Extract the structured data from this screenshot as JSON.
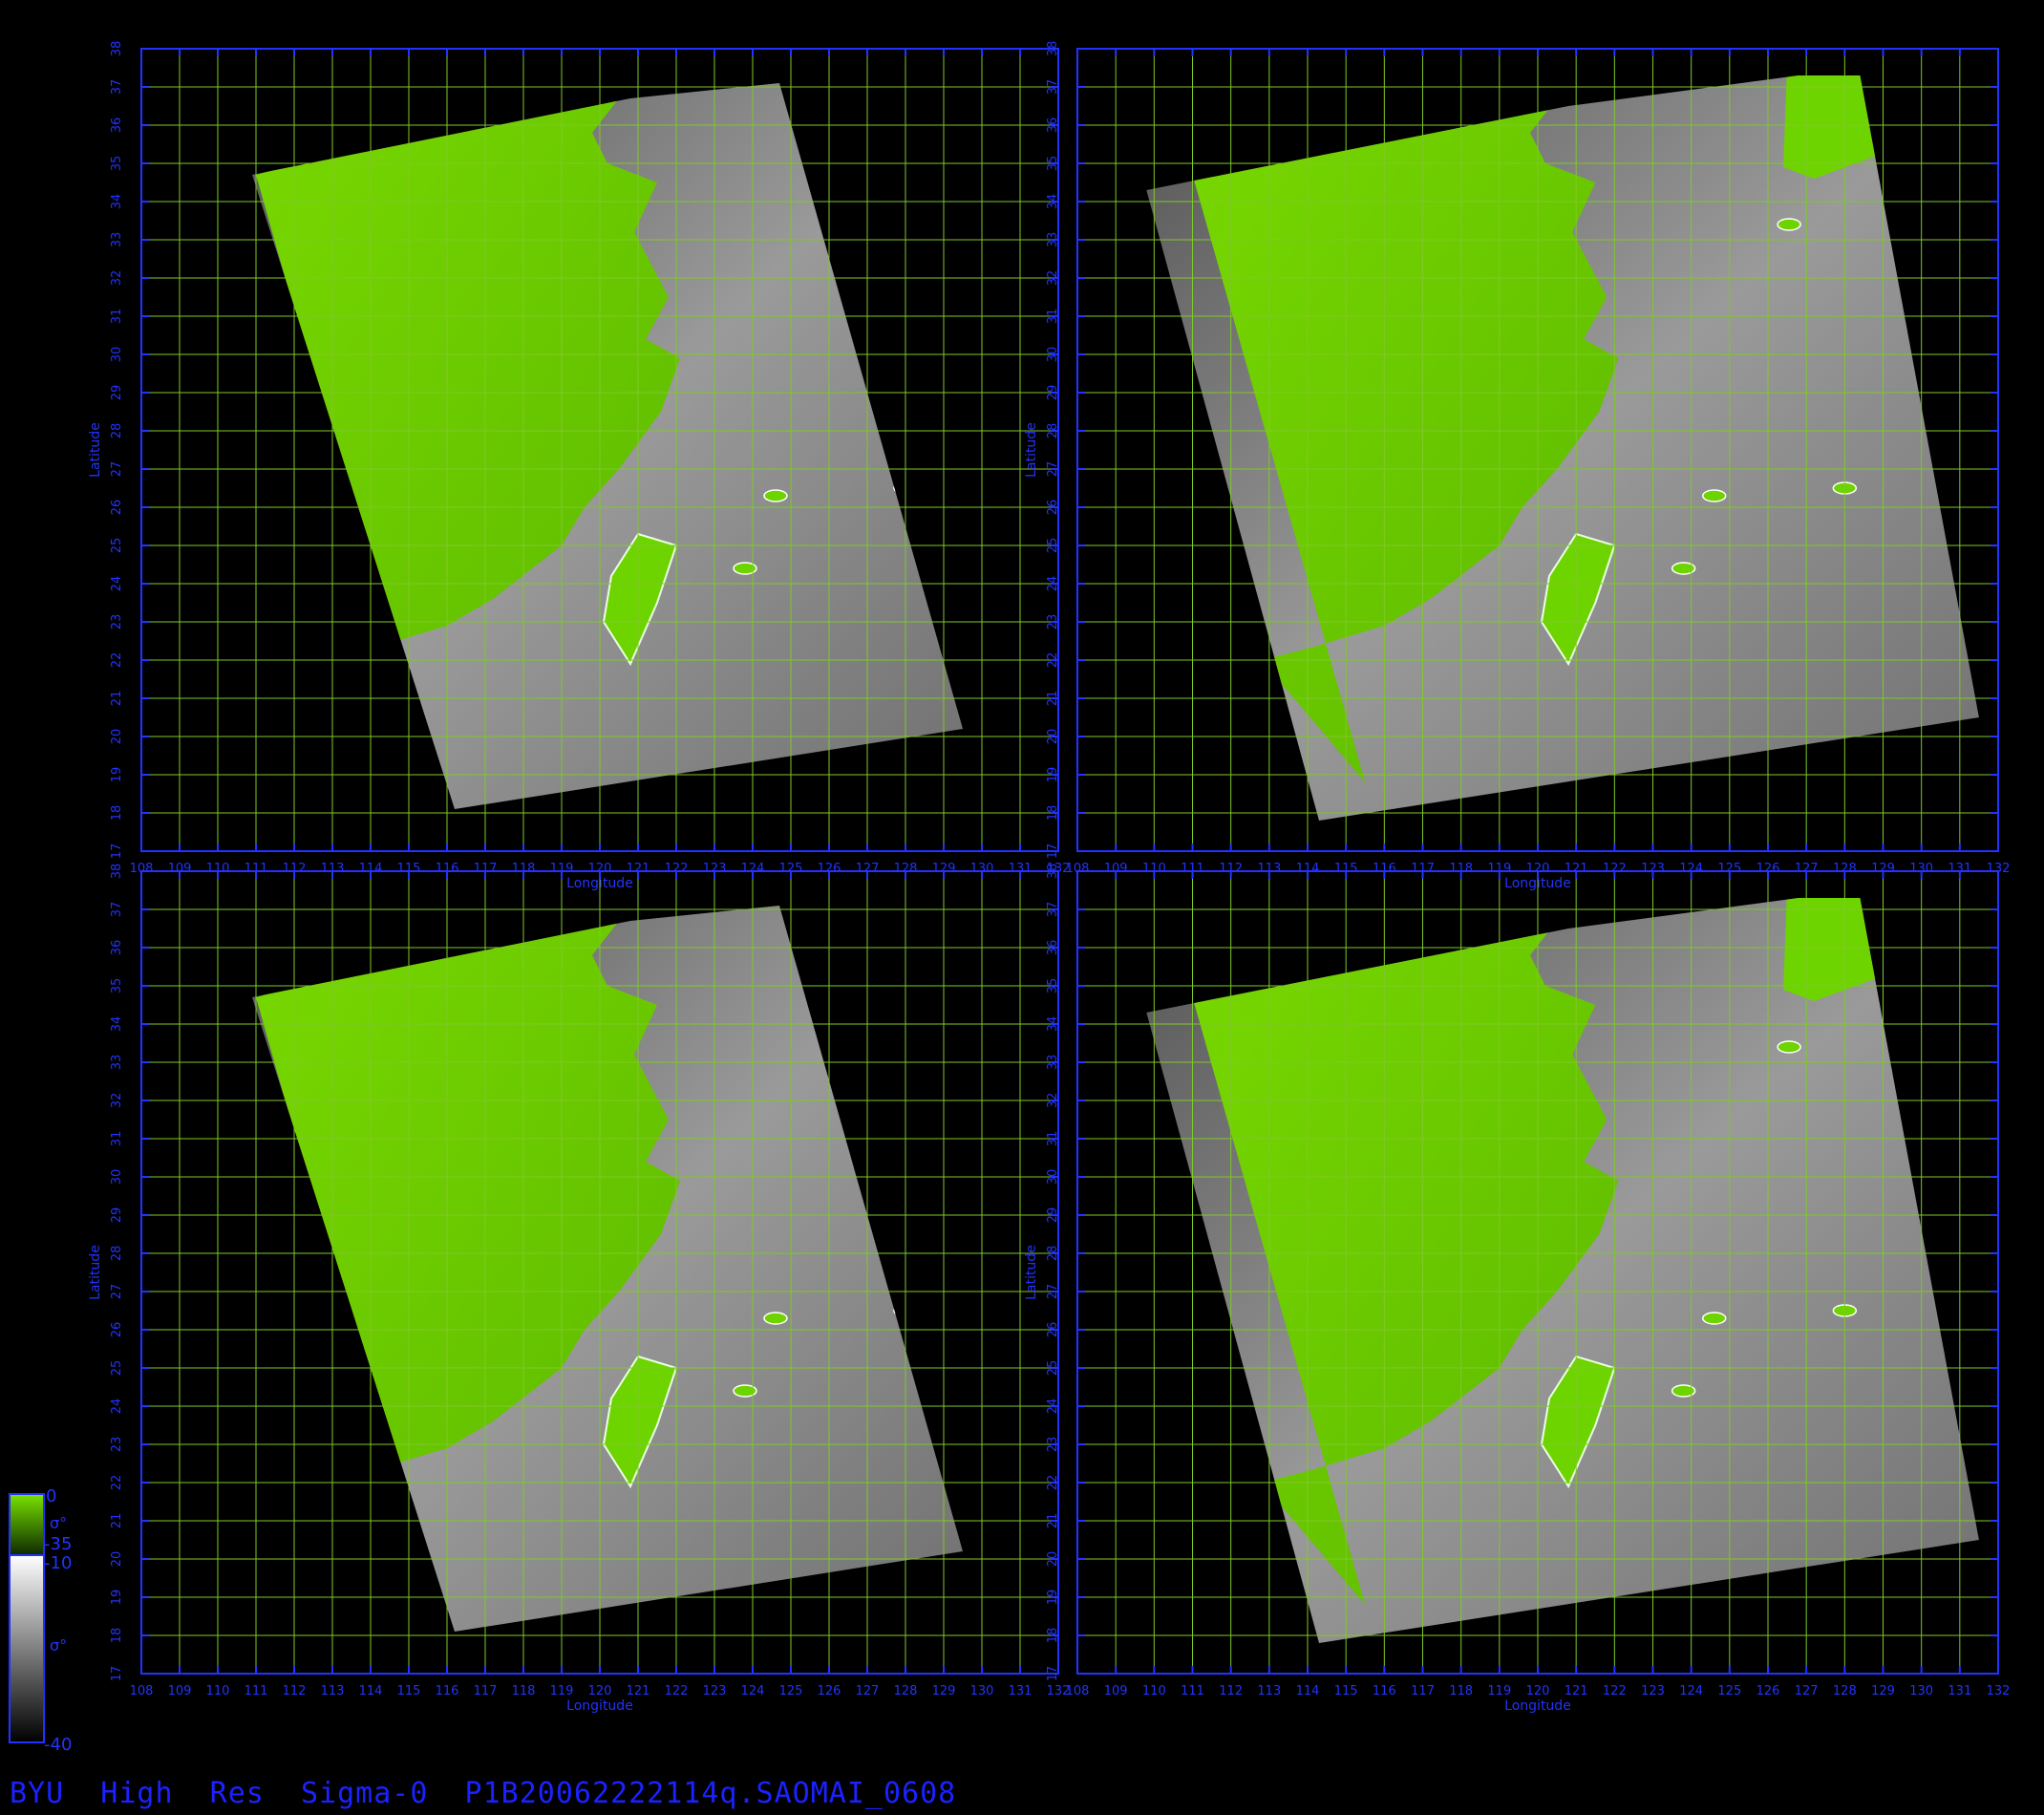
{
  "figure": {
    "footer_title": "BYU  High  Res  Sigma-0  P1B20062222114q.SAOMAI_0608",
    "xlabel": "Longitude",
    "ylabel": "Latitude",
    "lon_ticks": [
      "108",
      "109",
      "110",
      "111",
      "112",
      "113",
      "114",
      "115",
      "116",
      "117",
      "118",
      "119",
      "120",
      "121",
      "122",
      "123",
      "124",
      "125",
      "126",
      "127",
      "128",
      "129",
      "130",
      "131",
      "132"
    ],
    "lat_ticks": [
      "17",
      "18",
      "19",
      "20",
      "21",
      "22",
      "23",
      "24",
      "25",
      "26",
      "27",
      "28",
      "29",
      "30",
      "31",
      "32",
      "33",
      "34",
      "35",
      "36",
      "37",
      "38"
    ],
    "lon_range": [
      108,
      132
    ],
    "lat_range": [
      17,
      38
    ],
    "grid": true
  },
  "colors": {
    "land_green": "#6ed400",
    "axis_blue": "#2233ff",
    "grid_green": "#7fc82a",
    "background": "#000000"
  },
  "colorbar": {
    "land_max": "0",
    "land_min": "-35",
    "land_symbol": "σ°",
    "sea_max": "-10",
    "sea_min": "-40",
    "sea_symbol": "σ°"
  }
}
